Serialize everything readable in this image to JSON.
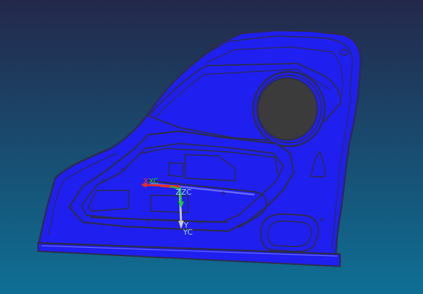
{
  "viewport": {
    "background_top": "#23284a",
    "background_bottom": "#0f6f95"
  },
  "model": {
    "fill_color": "#1f1ff0",
    "edge_color": "#2c2c4a",
    "highlight_color": "#6b6bff",
    "speaker_color": "#3b3b3b"
  },
  "triad": {
    "x_label": "X",
    "xc_label": "XC",
    "y_label": "Y",
    "yc_label": "YC",
    "z_label": "Z",
    "zc_label": "ZC",
    "x_color": "#e0302a",
    "y_color": "#c8c8c8",
    "z_color": "#1ccf2a",
    "label_color": "#9fd8e8"
  }
}
